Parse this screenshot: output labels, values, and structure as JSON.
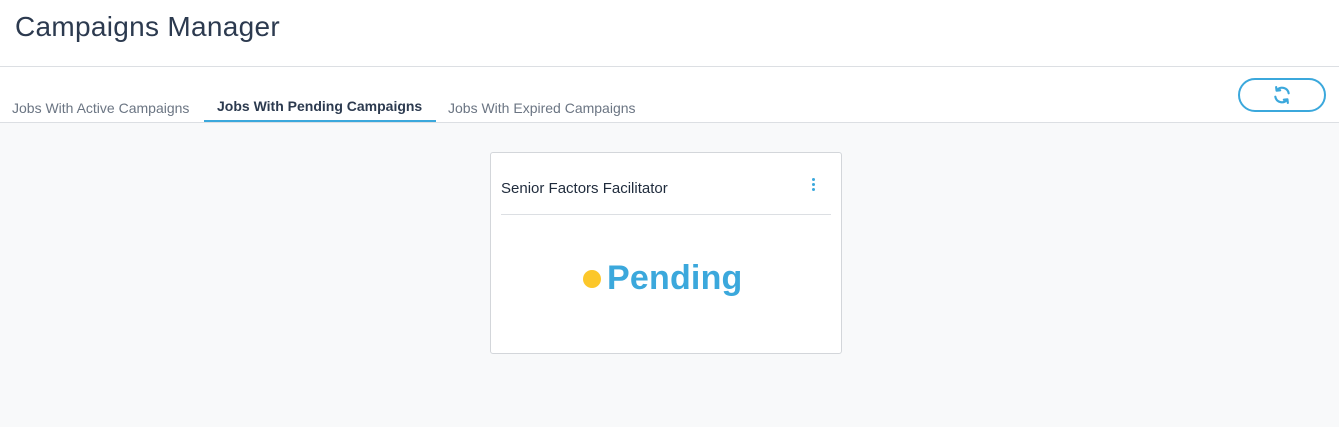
{
  "header": {
    "title": "Campaigns Manager"
  },
  "tabs": [
    {
      "label": "Jobs With Active Campaigns",
      "active": false
    },
    {
      "label": "Jobs With Pending Campaigns",
      "active": true
    },
    {
      "label": "Jobs With Expired Campaigns",
      "active": false
    }
  ],
  "toolbar": {
    "refresh_icon": "refresh-icon"
  },
  "cards": [
    {
      "title": "Senior Factors Facilitator",
      "menu_icon": "more-vertical-icon",
      "status": "Pending",
      "status_dot_color": "#fcc72a",
      "status_text_color": "#3ba8dc"
    }
  ],
  "colors": {
    "accent": "#3ba8dc",
    "pending": "#fcc72a",
    "title_text": "#2c3a4f",
    "muted_text": "#6b7583",
    "background": "#f8f9fa"
  }
}
